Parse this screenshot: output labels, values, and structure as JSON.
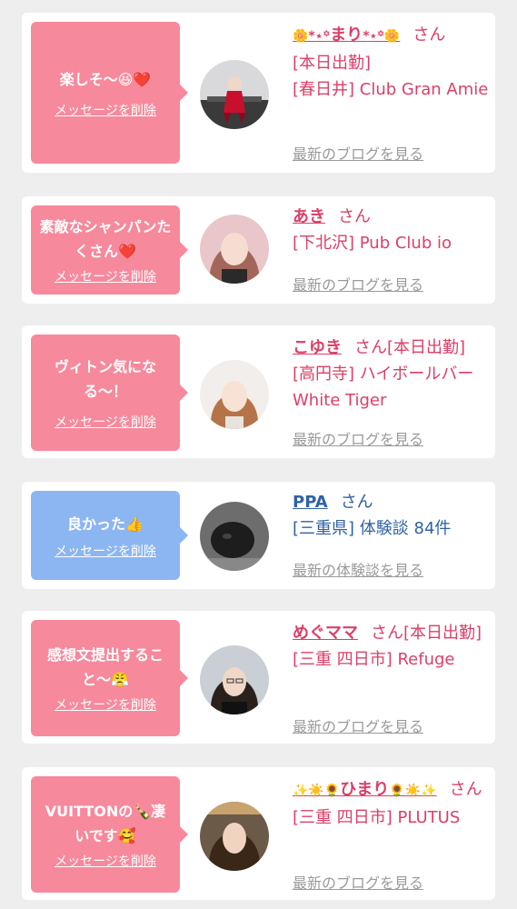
{
  "messages": [
    {
      "message": "楽しそ〜😆❤️",
      "delete_label": "メッセージを削除",
      "name_prefix": "🌼*⋆꙳",
      "name": "まり",
      "name_suffix": "*⋆꙳🌼",
      "san": "さん",
      "status": "[本日出勤]",
      "shop": "[春日井] Club Gran Amie",
      "link": "最新のブログを見る"
    },
    {
      "message": "素敵なシャンパンたくさん❤️",
      "delete_label": "メッセージを削除",
      "name": "あき",
      "san": "さん",
      "shop": "[下北沢] Pub Club io",
      "link": "最新のブログを見る"
    },
    {
      "message": "ヴィトン気になる〜！",
      "delete_label": "メッセージを削除",
      "name": "こゆき",
      "san": "さん",
      "status": "[本日出勤]",
      "shop": "[高円寺] ハイボールバー White Tiger",
      "link": "最新のブログを見る"
    },
    {
      "message": "良かった👍",
      "delete_label": "メッセージを削除",
      "name": "PPA",
      "san": "さん",
      "shop": "[三重県] 体験談 84件",
      "link": "最新の体験談を見る"
    },
    {
      "message": "感想文提出すること〜😤",
      "delete_label": "メッセージを削除",
      "name": "めぐママ",
      "san": "さん",
      "status": "[本日出勤]",
      "shop": "[三重 四日市] Refuge",
      "link": "最新のブログを見る"
    },
    {
      "message": "VUITTONの🍾凄いです🥰",
      "delete_label": "メッセージを削除",
      "name_prefix": "✨☀️🌻",
      "name": "ひまり",
      "name_suffix": "🌻☀️✨",
      "san": "さん",
      "shop": "[三重 四日市] PLUTUS",
      "link": "最新のブログを見る"
    }
  ],
  "colors": {
    "pink_bubble": "#f7899c",
    "blue_bubble": "#8cb6f2",
    "pink_text": "#dc3f66",
    "blue_text": "#2f62a4",
    "link_gray": "#9a9a9a",
    "page_bg": "#eeeeee"
  }
}
